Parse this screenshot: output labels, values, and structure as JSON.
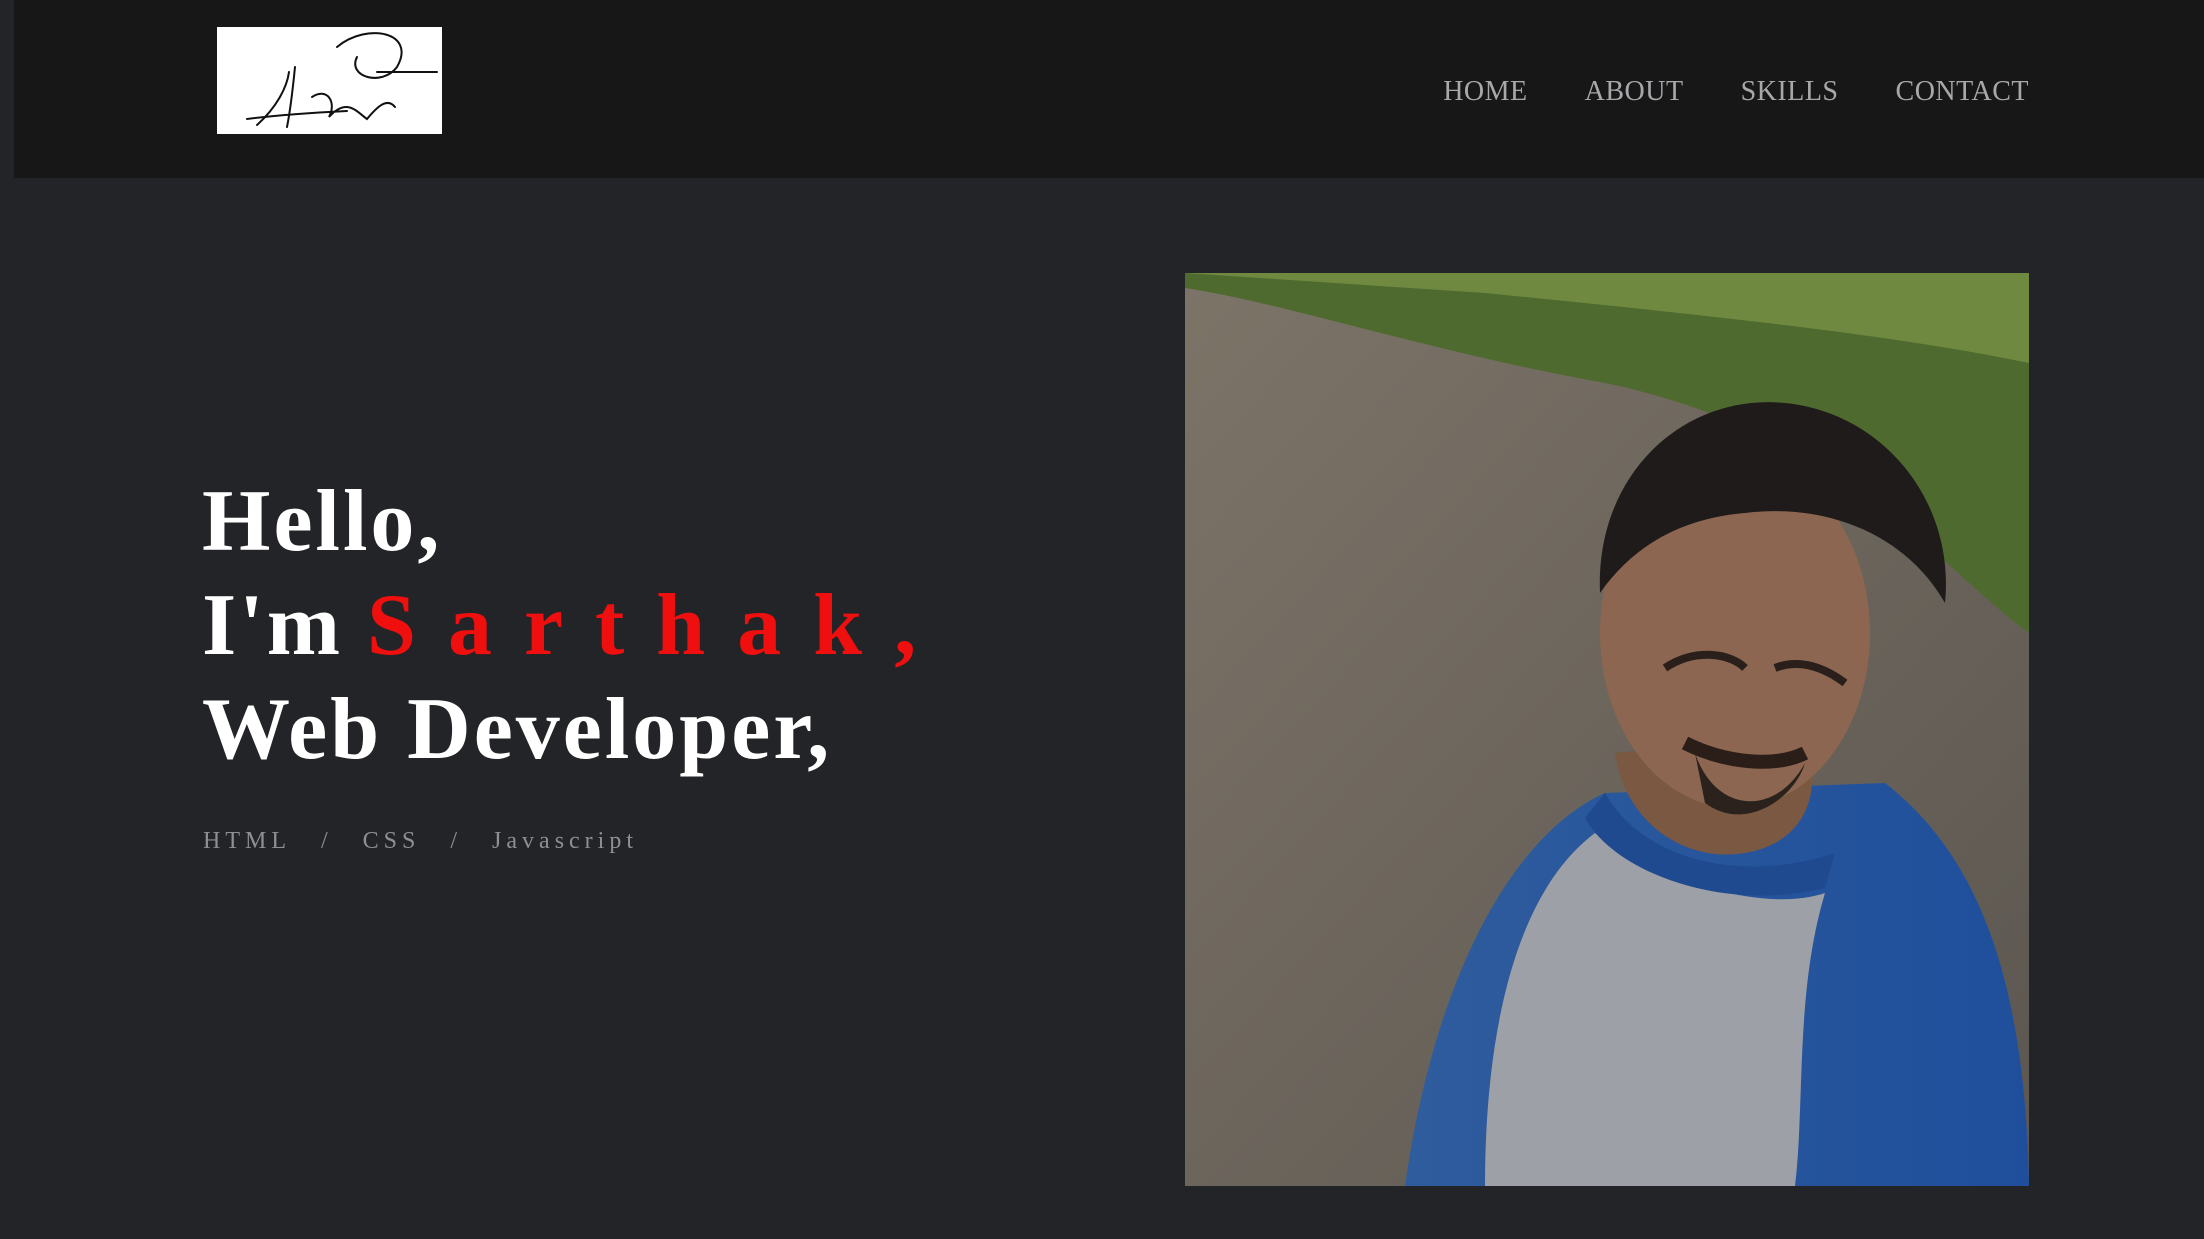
{
  "header": {
    "logo_alt": "signature-logo",
    "nav": [
      {
        "label": "HOME"
      },
      {
        "label": "ABOUT"
      },
      {
        "label": "SKILLS"
      },
      {
        "label": "CONTACT"
      }
    ]
  },
  "hero": {
    "line1": "Hello,",
    "line2_prefix": "I'm",
    "name": "Sarthak,",
    "line3": "Web Developer,",
    "skills": [
      "HTML",
      "/",
      "CSS",
      "/",
      "Javascript"
    ]
  },
  "photo": {
    "alt": "portrait-photo"
  },
  "colors": {
    "background": "#232427",
    "header": "#171718",
    "accent": "#ef0f0f",
    "nav_text": "#a8a8ab"
  }
}
